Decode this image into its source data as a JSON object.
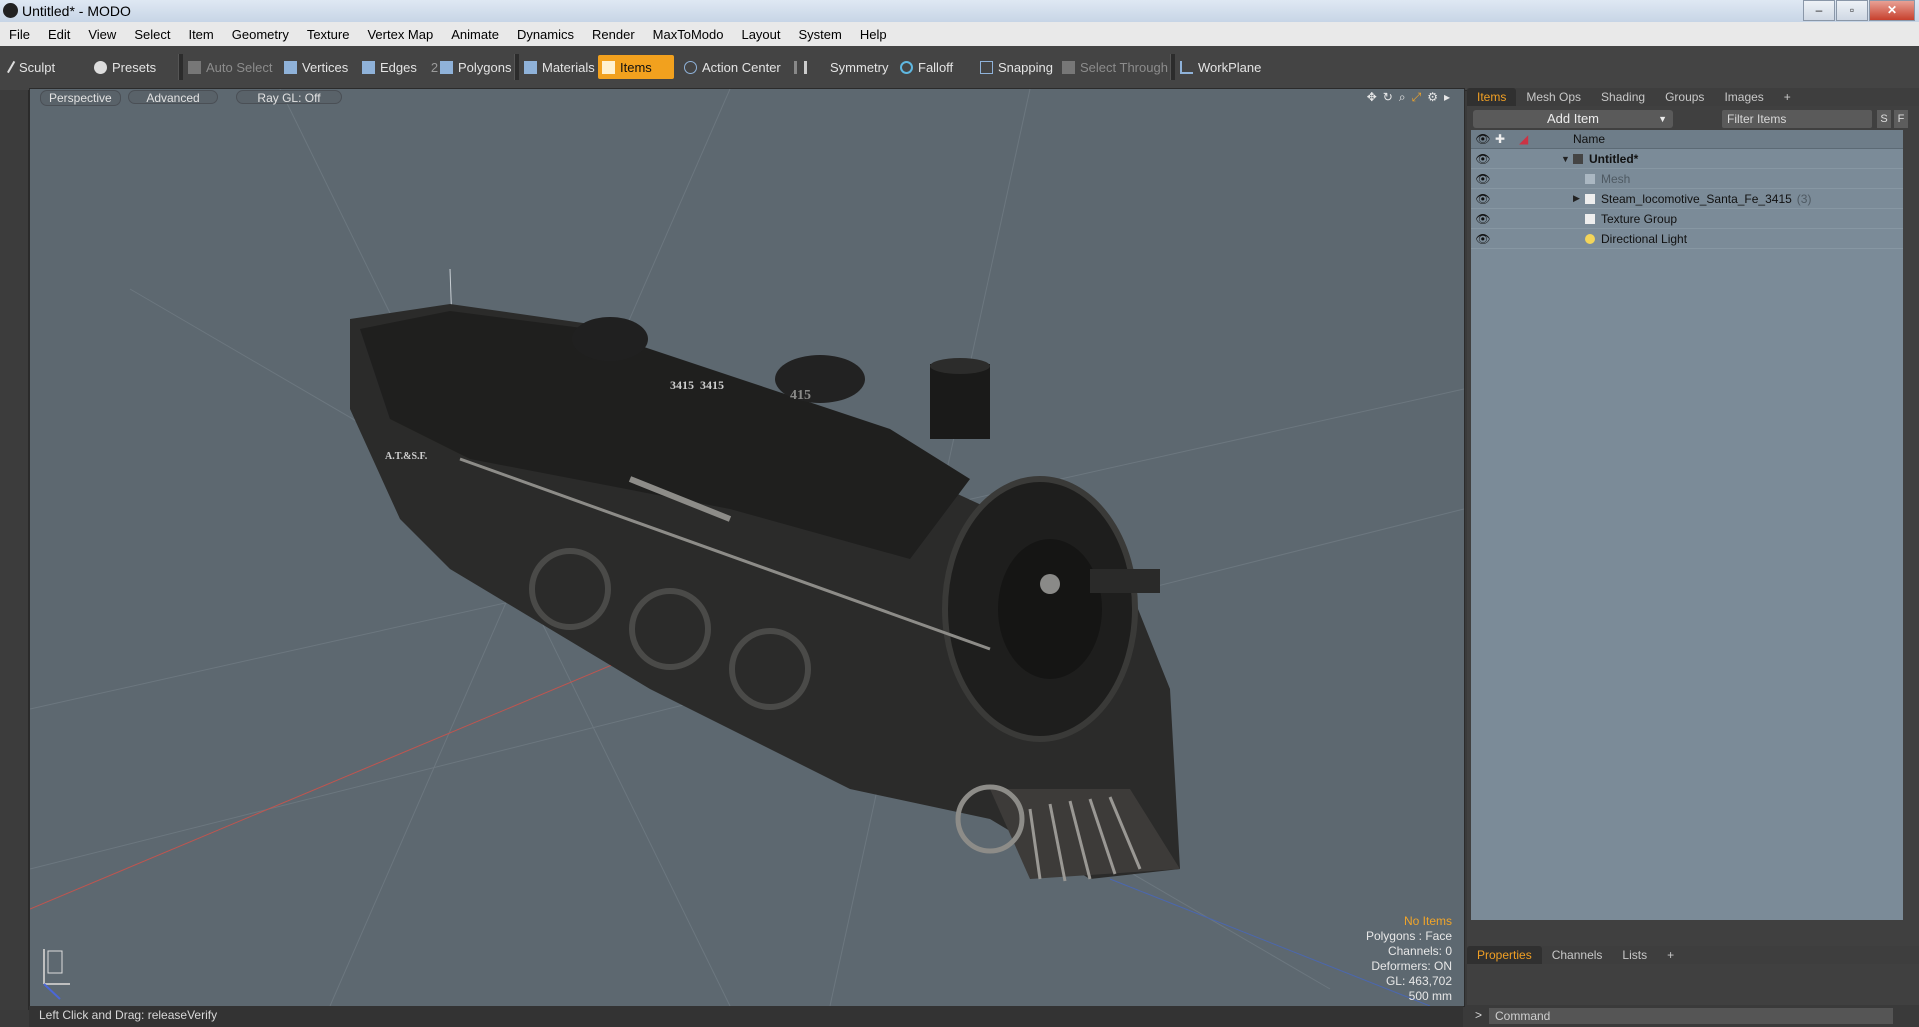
{
  "window": {
    "title": "Untitled* - MODO",
    "buttons": [
      "–",
      "▫",
      "✕"
    ]
  },
  "menu": [
    "File",
    "Edit",
    "View",
    "Select",
    "Item",
    "Geometry",
    "Texture",
    "Vertex Map",
    "Animate",
    "Dynamics",
    "Render",
    "MaxToModo",
    "Layout",
    "System",
    "Help"
  ],
  "toolbar": {
    "sculpt": "Sculpt",
    "presets": "Presets",
    "auto_select": "Auto Select",
    "vertices": "Vertices",
    "edges": "Edges",
    "edges_count": "2",
    "polygons": "Polygons",
    "materials": "Materials",
    "items": "Items",
    "action_center": "Action Center",
    "symmetry": "Symmetry",
    "falloff": "Falloff",
    "snapping": "Snapping",
    "select_through": "Select Through",
    "workplane": "WorkPlane",
    "accent": "#f2a11e"
  },
  "viewport": {
    "view": "Perspective",
    "shading": "Advanced",
    "raygl": "Ray GL: Off",
    "stats": {
      "no_items": "No Items",
      "polygons": "Polygons : Face",
      "channels": "Channels: 0",
      "deformers": "Deformers: ON",
      "gl": "GL: 463,702",
      "scale": "500 mm"
    },
    "loco_plates": [
      "3415",
      "3415",
      "A.T.&S.F.",
      "415"
    ]
  },
  "status": {
    "hint": "Left Click and Drag:  releaseVerify"
  },
  "panel": {
    "tabs": [
      "Items",
      "Mesh Ops",
      "Shading",
      "Groups",
      "Images",
      "+"
    ],
    "add_item": "Add Item",
    "filter": "Filter Items",
    "s_btn": "S",
    "f_btn": "F",
    "name_col": "Name",
    "tree": [
      {
        "label": "Untitled*",
        "bold": true,
        "icon": "scene-icon"
      },
      {
        "label": "Mesh",
        "dim": true,
        "icon": "mesh-icon"
      },
      {
        "label": "Steam_locomotive_Santa_Fe_3415",
        "count": "(3)",
        "icon": "group-icon"
      },
      {
        "label": "Texture Group",
        "icon": "group-icon"
      },
      {
        "label": "Directional Light",
        "icon": "light-icon"
      }
    ],
    "bottom_tabs": [
      "Properties",
      "Channels",
      "Lists",
      "+"
    ],
    "command_placeholder": "Command"
  }
}
